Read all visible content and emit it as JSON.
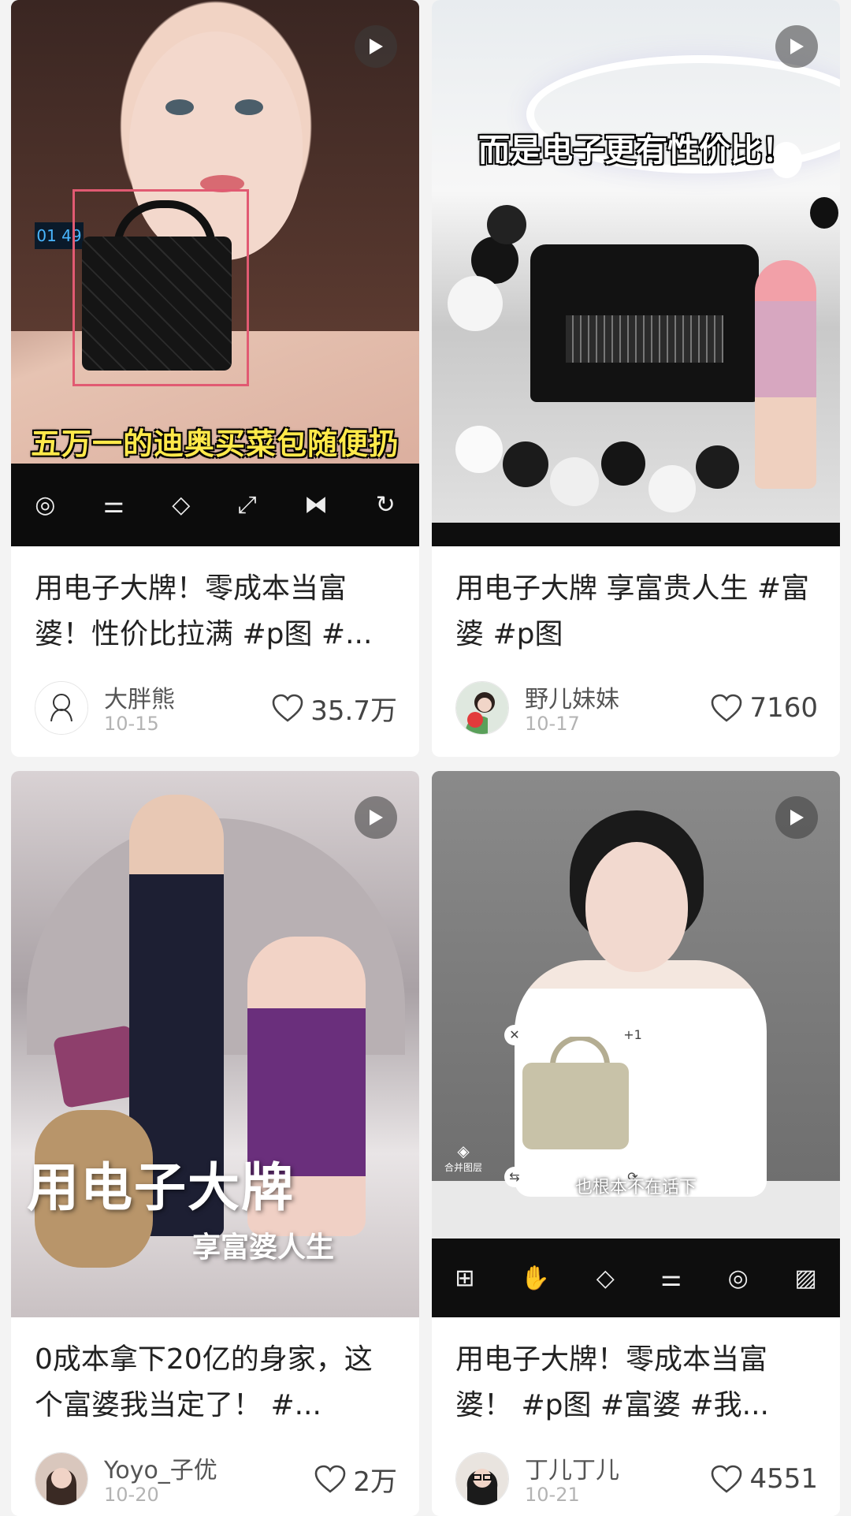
{
  "feed": {
    "cards": [
      {
        "title": "用电子大牌！零成本当富婆！性价比拉满 #p图 #...",
        "author": "大胖熊",
        "date": "10-15",
        "likes": "35.7万",
        "thumb_caption": "五万一的迪奥买菜包随便扔",
        "thumb_clock": "01 49"
      },
      {
        "title": "用电子大牌 享富贵人生 #富婆   #p图",
        "author": "野儿妹妹",
        "date": "10-17",
        "likes": "7160",
        "thumb_caption": "而是电子更有性价比！"
      },
      {
        "title": "0成本拿下20亿的身家，这个富婆我当定了！ #...",
        "author": "Yoyo_子优",
        "date": "10-20",
        "likes": "2万",
        "thumb_caption": "用电子大牌",
        "thumb_subcaption": "享富婆人生"
      },
      {
        "title": "用电子大牌！零成本当富婆！ #p图 #富婆 #我...",
        "author": "丁儿丁儿",
        "date": "10-21",
        "likes": "4551",
        "thumb_caption": "也根本不在话下",
        "thumb_layer_label": "合并图层",
        "thumb_badge": "+1"
      }
    ]
  },
  "icons": {
    "play": "play-icon",
    "heart": "heart-icon"
  },
  "colors": {
    "background": "#f3f3f3",
    "card": "#ffffff",
    "title_text": "#222222",
    "meta_text": "#555555",
    "date_text": "#b3b3b3",
    "caption_yellow": "#ffe94a"
  }
}
